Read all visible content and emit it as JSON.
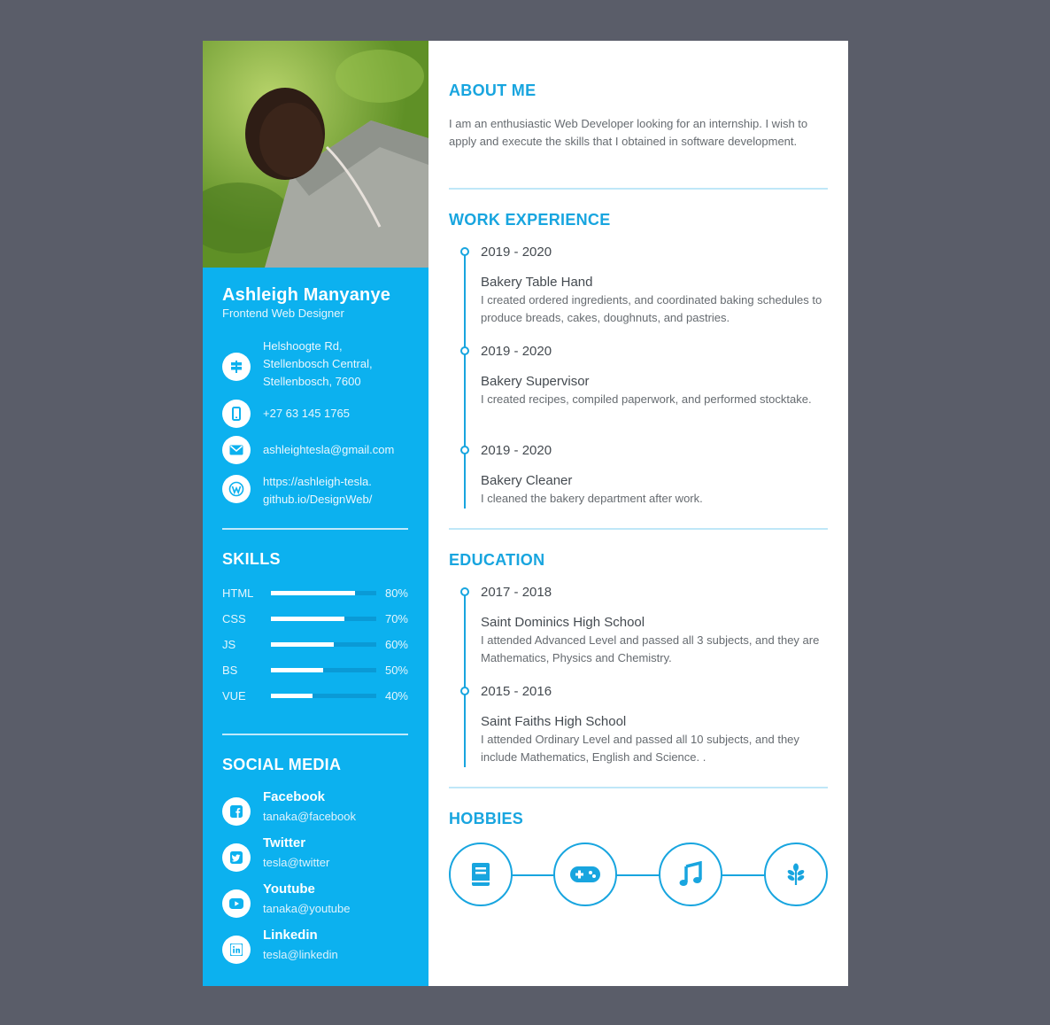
{
  "profile": {
    "name": "Ashleigh Manyanye",
    "role": "Frontend Web Designer",
    "photo_alt": "profile-photo"
  },
  "contact": {
    "address": [
      "Helshoogte Rd,",
      "Stellenbosch Central,",
      "Stellenbosch, 7600"
    ],
    "phone": "+27 63 145 1765",
    "email": "ashleightesla@gmail.com",
    "website": [
      "https://ashleigh-tesla.",
      "github.io/DesignWeb/"
    ]
  },
  "skills": {
    "heading": "SKILLS",
    "items": [
      {
        "name": "HTML",
        "percent": "80%",
        "level": 0.8
      },
      {
        "name": "CSS",
        "percent": "70%",
        "level": 0.7
      },
      {
        "name": "JS",
        "percent": "60%",
        "level": 0.6
      },
      {
        "name": "BS",
        "percent": "50%",
        "level": 0.5
      },
      {
        "name": "VUE",
        "percent": "40%",
        "level": 0.4
      }
    ]
  },
  "social": {
    "heading": "SOCIAL MEDIA",
    "items": [
      {
        "title": "Facebook",
        "handle": "tanaka@facebook",
        "icon": "facebook-icon"
      },
      {
        "title": "Twitter",
        "handle": "tesla@twitter",
        "icon": "twitter-icon"
      },
      {
        "title": "Youtube",
        "handle": "tanaka@youtube",
        "icon": "youtube-icon"
      },
      {
        "title": "Linkedin",
        "handle": "tesla@linkedin",
        "icon": "linkedin-icon"
      }
    ]
  },
  "about": {
    "heading": "ABOUT ME",
    "text": "I am an enthusiastic Web Developer looking for an internship. I wish to apply and execute the skills that I obtained in software development."
  },
  "work": {
    "heading": "WORK EXPERIENCE",
    "items": [
      {
        "date": "2019 - 2020",
        "title": "Bakery Table Hand",
        "desc": "I created ordered ingredients, and coordinated baking schedules to produce breads, cakes, doughnuts, and pastries."
      },
      {
        "date": "2019 - 2020",
        "title": "Bakery Supervisor",
        "desc": "I created recipes, compiled paperwork, and performed stocktake."
      },
      {
        "date": "2019 - 2020",
        "title": "Bakery Cleaner",
        "desc": "I cleaned the bakery department after work."
      }
    ]
  },
  "education": {
    "heading": "EDUCATION",
    "items": [
      {
        "date": "2017 - 2018",
        "title": "Saint Dominics High School",
        "desc": "I attended Advanced Level and passed all 3 subjects, and they are Mathematics, Physics and Chemistry."
      },
      {
        "date": "2015 - 2016",
        "title": "Saint Faiths High School",
        "desc": "I attended Ordinary Level and passed all 10 subjects, and they include Mathematics, English and Science. ."
      }
    ]
  },
  "hobbies": {
    "heading": "HOBBIES",
    "icons": [
      "book-icon",
      "gamepad-icon",
      "music-icon",
      "plant-icon"
    ]
  },
  "colors": {
    "accent": "#0cb1ef",
    "heading_blue": "#18a5df",
    "background": "#5a5d69"
  }
}
